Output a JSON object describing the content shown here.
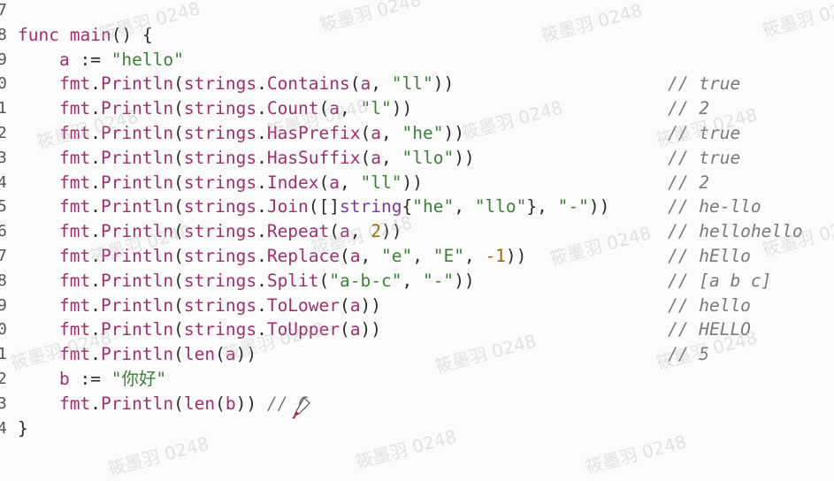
{
  "lines": [
    {
      "n": "7",
      "tokens": [],
      "comment": ""
    },
    {
      "n": "8",
      "tokens": [
        [
          "func",
          "k-kw"
        ],
        [
          " ",
          ""
        ],
        [
          "main",
          "k-id"
        ],
        [
          "() {",
          "k-op"
        ]
      ],
      "comment": ""
    },
    {
      "n": "9",
      "tokens": [
        [
          "    ",
          ""
        ],
        [
          "a",
          "k-id"
        ],
        [
          " := ",
          "k-op"
        ],
        [
          "\"hello\"",
          "k-str"
        ]
      ],
      "comment": ""
    },
    {
      "n": "0",
      "tokens": [
        [
          "    ",
          ""
        ],
        [
          "fmt",
          "k-pkg"
        ],
        [
          ".",
          "k-op"
        ],
        [
          "Println",
          "k-fn"
        ],
        [
          "(",
          "k-op"
        ],
        [
          "strings",
          "k-pkg"
        ],
        [
          ".",
          "k-op"
        ],
        [
          "Contains",
          "k-fn"
        ],
        [
          "(",
          "k-op"
        ],
        [
          "a",
          "k-id"
        ],
        [
          ", ",
          "k-op"
        ],
        [
          "\"ll\"",
          "k-str"
        ],
        [
          "))",
          "k-op"
        ]
      ],
      "comment": "// true"
    },
    {
      "n": "1",
      "tokens": [
        [
          "    ",
          ""
        ],
        [
          "fmt",
          "k-pkg"
        ],
        [
          ".",
          "k-op"
        ],
        [
          "Println",
          "k-fn"
        ],
        [
          "(",
          "k-op"
        ],
        [
          "strings",
          "k-pkg"
        ],
        [
          ".",
          "k-op"
        ],
        [
          "Count",
          "k-fn"
        ],
        [
          "(",
          "k-op"
        ],
        [
          "a",
          "k-id"
        ],
        [
          ", ",
          "k-op"
        ],
        [
          "\"l\"",
          "k-str"
        ],
        [
          "))",
          "k-op"
        ]
      ],
      "comment": "// 2"
    },
    {
      "n": "2",
      "tokens": [
        [
          "    ",
          ""
        ],
        [
          "fmt",
          "k-pkg"
        ],
        [
          ".",
          "k-op"
        ],
        [
          "Println",
          "k-fn"
        ],
        [
          "(",
          "k-op"
        ],
        [
          "strings",
          "k-pkg"
        ],
        [
          ".",
          "k-op"
        ],
        [
          "HasPrefix",
          "k-fn"
        ],
        [
          "(",
          "k-op"
        ],
        [
          "a",
          "k-id"
        ],
        [
          ", ",
          "k-op"
        ],
        [
          "\"he\"",
          "k-str"
        ],
        [
          "))",
          "k-op"
        ]
      ],
      "comment": "// true"
    },
    {
      "n": "3",
      "tokens": [
        [
          "    ",
          ""
        ],
        [
          "fmt",
          "k-pkg"
        ],
        [
          ".",
          "k-op"
        ],
        [
          "Println",
          "k-fn"
        ],
        [
          "(",
          "k-op"
        ],
        [
          "strings",
          "k-pkg"
        ],
        [
          ".",
          "k-op"
        ],
        [
          "HasSuffix",
          "k-fn"
        ],
        [
          "(",
          "k-op"
        ],
        [
          "a",
          "k-id"
        ],
        [
          ", ",
          "k-op"
        ],
        [
          "\"llo\"",
          "k-str"
        ],
        [
          "))",
          "k-op"
        ]
      ],
      "comment": "// true"
    },
    {
      "n": "4",
      "tokens": [
        [
          "    ",
          ""
        ],
        [
          "fmt",
          "k-pkg"
        ],
        [
          ".",
          "k-op"
        ],
        [
          "Println",
          "k-fn"
        ],
        [
          "(",
          "k-op"
        ],
        [
          "strings",
          "k-pkg"
        ],
        [
          ".",
          "k-op"
        ],
        [
          "Index",
          "k-fn"
        ],
        [
          "(",
          "k-op"
        ],
        [
          "a",
          "k-id"
        ],
        [
          ", ",
          "k-op"
        ],
        [
          "\"ll\"",
          "k-str"
        ],
        [
          "))",
          "k-op"
        ]
      ],
      "comment": "// 2"
    },
    {
      "n": "5",
      "tokens": [
        [
          "    ",
          ""
        ],
        [
          "fmt",
          "k-pkg"
        ],
        [
          ".",
          "k-op"
        ],
        [
          "Println",
          "k-fn"
        ],
        [
          "(",
          "k-op"
        ],
        [
          "strings",
          "k-pkg"
        ],
        [
          ".",
          "k-op"
        ],
        [
          "Join",
          "k-fn"
        ],
        [
          "([]",
          "k-op"
        ],
        [
          "string",
          "k-type"
        ],
        [
          "{",
          "k-op"
        ],
        [
          "\"he\"",
          "k-str"
        ],
        [
          ", ",
          "k-op"
        ],
        [
          "\"llo\"",
          "k-str"
        ],
        [
          "}, ",
          "k-op"
        ],
        [
          "\"-\"",
          "k-str"
        ],
        [
          "))",
          "k-op"
        ]
      ],
      "comment": "// he-llo"
    },
    {
      "n": "6",
      "tokens": [
        [
          "    ",
          ""
        ],
        [
          "fmt",
          "k-pkg"
        ],
        [
          ".",
          "k-op"
        ],
        [
          "Println",
          "k-fn"
        ],
        [
          "(",
          "k-op"
        ],
        [
          "strings",
          "k-pkg"
        ],
        [
          ".",
          "k-op"
        ],
        [
          "Repeat",
          "k-fn"
        ],
        [
          "(",
          "k-op"
        ],
        [
          "a",
          "k-id"
        ],
        [
          ", ",
          "k-op"
        ],
        [
          "2",
          "k-num"
        ],
        [
          "))",
          "k-op"
        ]
      ],
      "comment": "// hellohello"
    },
    {
      "n": "7",
      "tokens": [
        [
          "    ",
          ""
        ],
        [
          "fmt",
          "k-pkg"
        ],
        [
          ".",
          "k-op"
        ],
        [
          "Println",
          "k-fn"
        ],
        [
          "(",
          "k-op"
        ],
        [
          "strings",
          "k-pkg"
        ],
        [
          ".",
          "k-op"
        ],
        [
          "Replace",
          "k-fn"
        ],
        [
          "(",
          "k-op"
        ],
        [
          "a",
          "k-id"
        ],
        [
          ", ",
          "k-op"
        ],
        [
          "\"e\"",
          "k-str"
        ],
        [
          ", ",
          "k-op"
        ],
        [
          "\"E\"",
          "k-str"
        ],
        [
          ", ",
          "k-op"
        ],
        [
          "-1",
          "k-num"
        ],
        [
          "))",
          "k-op"
        ]
      ],
      "comment": "// hEllo"
    },
    {
      "n": "8",
      "tokens": [
        [
          "    ",
          ""
        ],
        [
          "fmt",
          "k-pkg"
        ],
        [
          ".",
          "k-op"
        ],
        [
          "Println",
          "k-fn"
        ],
        [
          "(",
          "k-op"
        ],
        [
          "strings",
          "k-pkg"
        ],
        [
          ".",
          "k-op"
        ],
        [
          "Split",
          "k-fn"
        ],
        [
          "(",
          "k-op"
        ],
        [
          "\"a-b-c\"",
          "k-str"
        ],
        [
          ", ",
          "k-op"
        ],
        [
          "\"-\"",
          "k-str"
        ],
        [
          "))",
          "k-op"
        ]
      ],
      "comment": "// [a b c]"
    },
    {
      "n": "9",
      "tokens": [
        [
          "    ",
          ""
        ],
        [
          "fmt",
          "k-pkg"
        ],
        [
          ".",
          "k-op"
        ],
        [
          "Println",
          "k-fn"
        ],
        [
          "(",
          "k-op"
        ],
        [
          "strings",
          "k-pkg"
        ],
        [
          ".",
          "k-op"
        ],
        [
          "ToLower",
          "k-fn"
        ],
        [
          "(",
          "k-op"
        ],
        [
          "a",
          "k-id"
        ],
        [
          "))",
          "k-op"
        ]
      ],
      "comment": "// hello"
    },
    {
      "n": "0",
      "tokens": [
        [
          "    ",
          ""
        ],
        [
          "fmt",
          "k-pkg"
        ],
        [
          ".",
          "k-op"
        ],
        [
          "Println",
          "k-fn"
        ],
        [
          "(",
          "k-op"
        ],
        [
          "strings",
          "k-pkg"
        ],
        [
          ".",
          "k-op"
        ],
        [
          "ToUpper",
          "k-fn"
        ],
        [
          "(",
          "k-op"
        ],
        [
          "a",
          "k-id"
        ],
        [
          "))",
          "k-op"
        ]
      ],
      "comment": "// HELLO"
    },
    {
      "n": "1",
      "tokens": [
        [
          "    ",
          ""
        ],
        [
          "fmt",
          "k-pkg"
        ],
        [
          ".",
          "k-op"
        ],
        [
          "Println",
          "k-fn"
        ],
        [
          "(",
          "k-op"
        ],
        [
          "len",
          "k-bi"
        ],
        [
          "(",
          "k-op"
        ],
        [
          "a",
          "k-id"
        ],
        [
          "))",
          "k-op"
        ]
      ],
      "comment": "// 5"
    },
    {
      "n": "2",
      "tokens": [
        [
          "    ",
          ""
        ],
        [
          "b",
          "k-id"
        ],
        [
          " := ",
          "k-op"
        ],
        [
          "\"你好\"",
          "k-str"
        ]
      ],
      "comment": ""
    },
    {
      "n": "3",
      "tokens": [
        [
          "    ",
          ""
        ],
        [
          "fmt",
          "k-pkg"
        ],
        [
          ".",
          "k-op"
        ],
        [
          "Println",
          "k-fn"
        ],
        [
          "(",
          "k-op"
        ],
        [
          "len",
          "k-bi"
        ],
        [
          "(",
          "k-op"
        ],
        [
          "b",
          "k-id"
        ],
        [
          "))",
          "k-op"
        ],
        [
          " // 6",
          "inline-comment"
        ]
      ],
      "comment": ""
    },
    {
      "n": "4",
      "tokens": [
        [
          "}",
          "k-op"
        ]
      ],
      "comment": ""
    }
  ],
  "watermark_text": "筱墨羽 0248",
  "pen_cursor_icon": "pen-cursor-icon"
}
